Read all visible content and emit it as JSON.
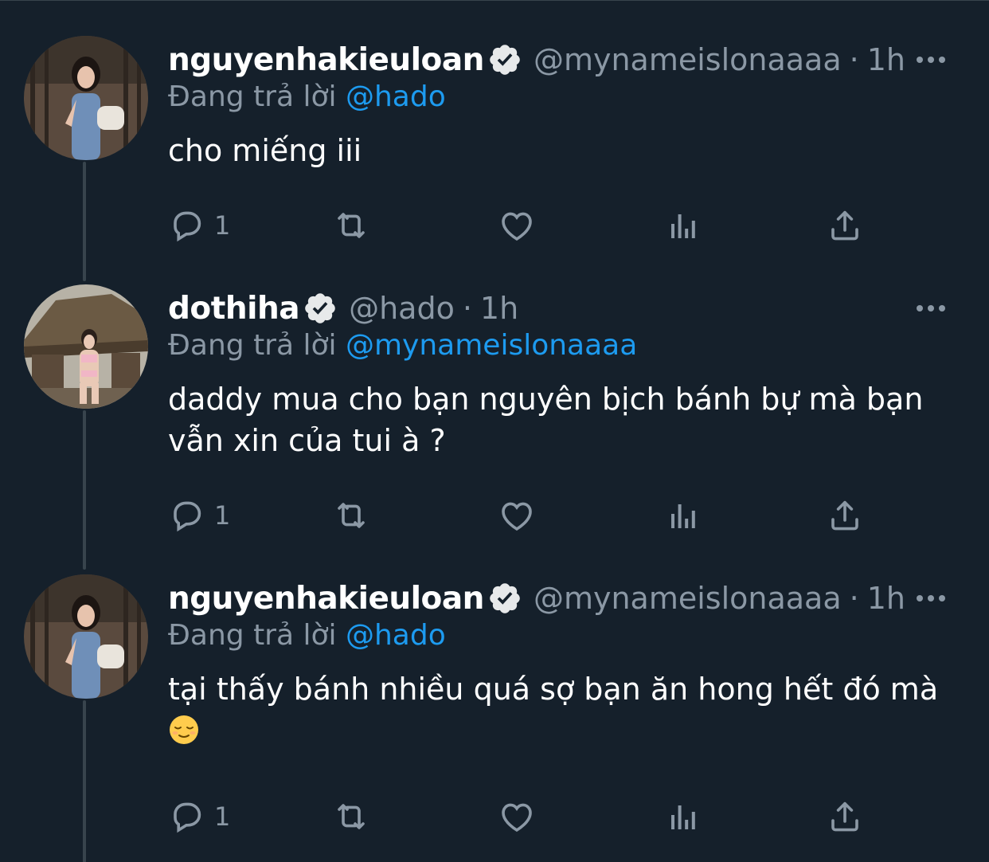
{
  "tweets": [
    {
      "display_name": "nguyenhakieuloan",
      "handle": "@mynameislonaaaa",
      "separator": "·",
      "time": "1h",
      "reply_prefix": "Đang trả lời",
      "reply_to": "@hado",
      "text_lines": [
        "cho miếng iii"
      ],
      "emoji": "",
      "reply_count": "1",
      "avatar_icon": "avatar-photo"
    },
    {
      "display_name": "dothiha",
      "handle": "@hado",
      "separator": "·",
      "time": "1h",
      "reply_prefix": "Đang trả lời",
      "reply_to": "@mynameislonaaaa",
      "text_lines": [
        "daddy mua cho bạn nguyên bịch bánh bự mà bạn",
        "vẫn xin của tui à ?"
      ],
      "emoji": "",
      "reply_count": "1",
      "avatar_icon": "avatar-photo"
    },
    {
      "display_name": "nguyenhakieuloan",
      "handle": "@mynameislonaaaa",
      "separator": "·",
      "time": "1h",
      "reply_prefix": "Đang trả lời",
      "reply_to": "@hado",
      "text_lines": [
        "tại thấy bánh nhiều quá sợ bạn ăn hong hết đó mà"
      ],
      "emoji": "relieved-face",
      "reply_count": "1",
      "avatar_icon": "avatar-photo"
    }
  ],
  "colors": {
    "background": "#15202b",
    "secondary_text": "#8b98a5",
    "link": "#1d9bf0",
    "thread_line": "#38444d"
  },
  "icons": [
    "reply-icon",
    "retweet-icon",
    "like-icon",
    "views-icon",
    "share-icon",
    "more-icon",
    "verified-badge-icon"
  ]
}
